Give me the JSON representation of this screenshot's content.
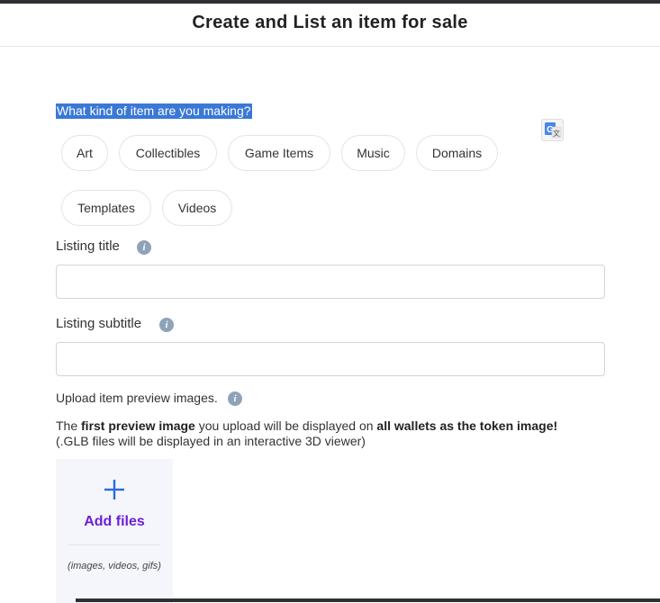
{
  "header": {
    "title": "Create and List an item for sale"
  },
  "item_type": {
    "question": "What kind of item are you making?",
    "options": [
      "Art",
      "Collectibles",
      "Game Items",
      "Music",
      "Domains",
      "Templates",
      "Videos"
    ]
  },
  "listing_title": {
    "label": "Listing title",
    "value": ""
  },
  "listing_subtitle": {
    "label": "Listing subtitle",
    "value": ""
  },
  "upload": {
    "label": "Upload item preview images.",
    "desc_pre": "The ",
    "desc_bold1": "first preview image",
    "desc_mid": " you upload will be displayed on ",
    "desc_bold2": "all wallets as the token image!",
    "desc_line2": "(.GLB files will be displayed in an interactive 3D viewer)",
    "button_label": "Add files",
    "hint": "(images, videos, gifs)"
  },
  "icons": {
    "info": "info-icon",
    "translate": "google-translate-icon",
    "add": "plus-icon"
  },
  "colors": {
    "accent_blue": "#2a6bd9",
    "accent_purple": "#6b1fd6",
    "selection": "#3a78d6"
  }
}
